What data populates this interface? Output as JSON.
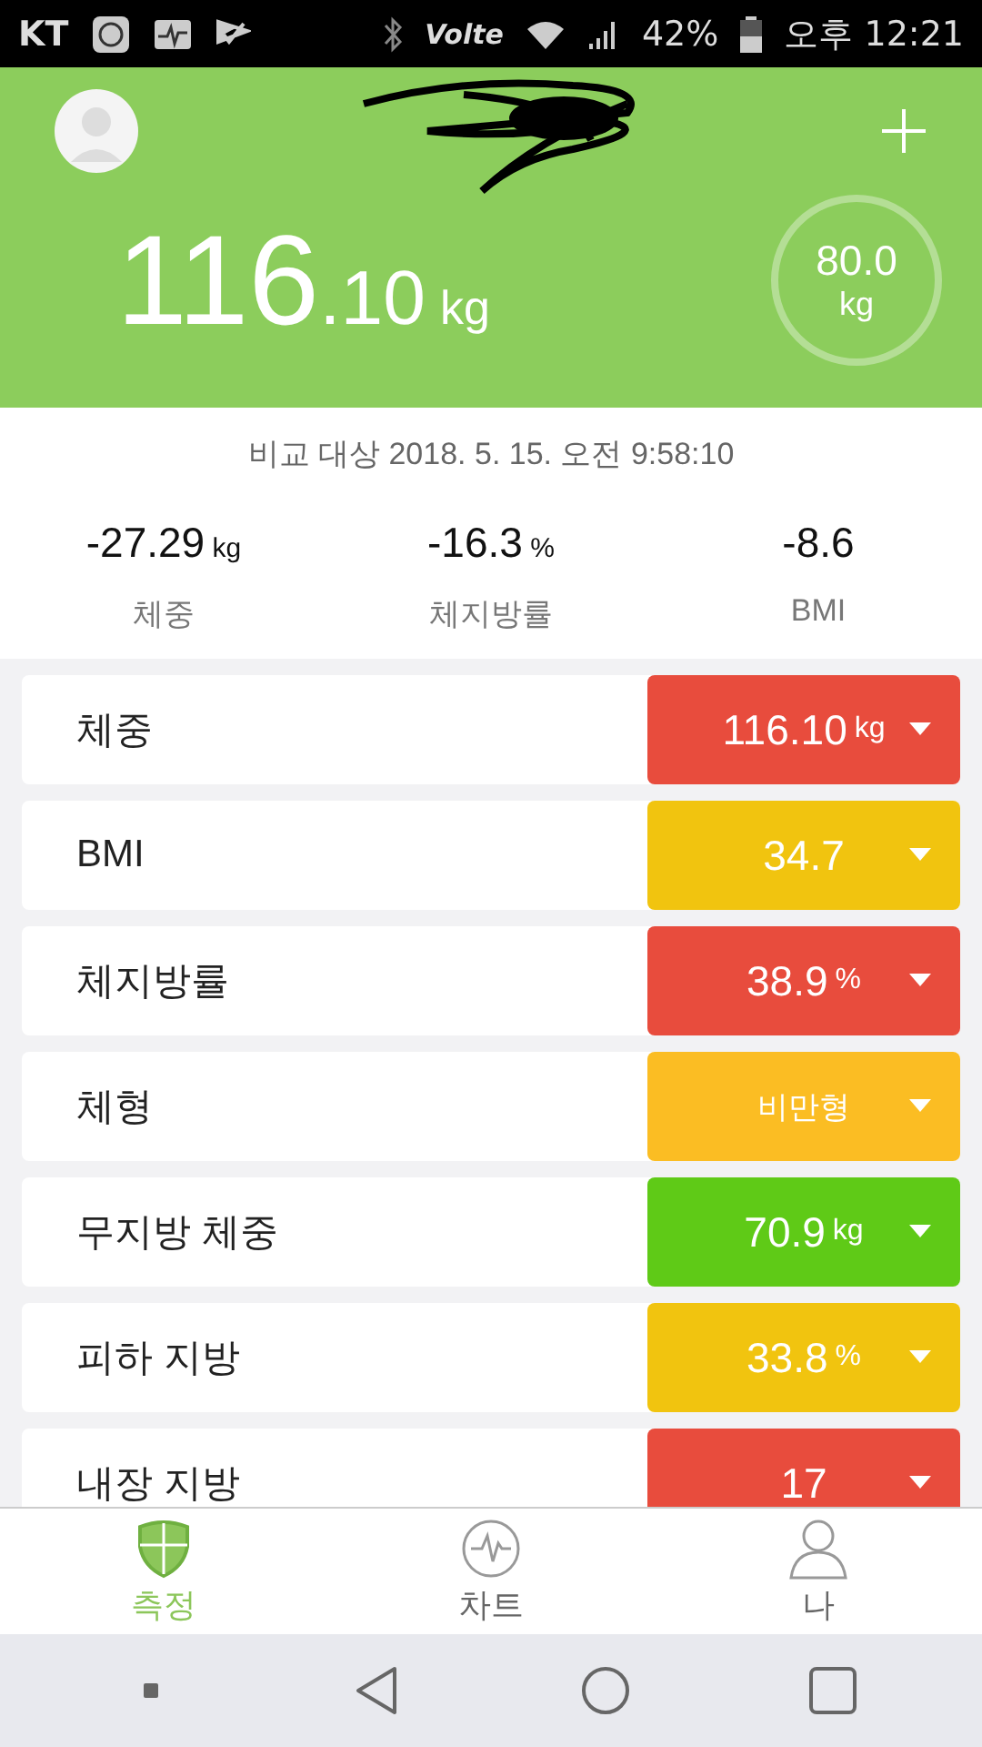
{
  "status_bar": {
    "carrier": "KT",
    "network": "Volte",
    "battery": "42%",
    "time": "오후 12:21"
  },
  "header": {
    "weight_int": "116",
    "weight_dec": ".10",
    "weight_unit": "kg",
    "goal_value": "80.0",
    "goal_unit": "kg"
  },
  "comparison": {
    "label": "비교 대상 2018. 5. 15. 오전 9:58:10",
    "stats": [
      {
        "value": "-27.29",
        "unit": "kg",
        "label": "체중"
      },
      {
        "value": "-16.3",
        "unit": "%",
        "label": "체지방률"
      },
      {
        "value": "-8.6",
        "label": "BMI"
      }
    ]
  },
  "metrics": [
    {
      "name": "체중",
      "value": "116.10",
      "unit": "kg",
      "color": "#e84c3d"
    },
    {
      "name": "BMI",
      "value": "34.7",
      "color": "#f1c40f"
    },
    {
      "name": "체지방률",
      "value": "38.9",
      "unit": "%",
      "color": "#e84c3d"
    },
    {
      "name": "체형",
      "value": "비만형",
      "kind": "text",
      "color": "#fbbd23"
    },
    {
      "name": "무지방 체중",
      "value": "70.9",
      "unit": "kg",
      "color": "#5fca17"
    },
    {
      "name": "피하 지방",
      "value": "33.8",
      "unit": "%",
      "color": "#f1c40f"
    },
    {
      "name": "내장 지방",
      "value": "17",
      "color": "#e84c3d"
    }
  ],
  "tabs": [
    {
      "label": "측정",
      "kind": "measure",
      "selected": true
    },
    {
      "label": "차트",
      "kind": "chart",
      "selected": false
    },
    {
      "label": "나",
      "kind": "profile",
      "selected": false
    }
  ]
}
